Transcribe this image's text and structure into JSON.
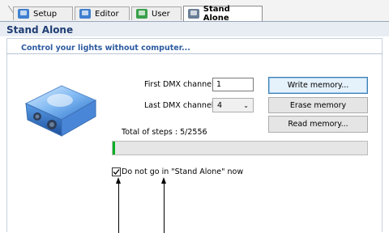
{
  "tabs": [
    {
      "label": "Setup",
      "icon": "setup-icon"
    },
    {
      "label": "Editor",
      "icon": "editor-icon"
    },
    {
      "label": "User",
      "icon": "user-icon"
    },
    {
      "label": "Stand Alone",
      "icon": "stand-alone-icon",
      "active": true
    }
  ],
  "page": {
    "title": "Stand Alone",
    "subtitle": "Control your lights without computer..."
  },
  "form": {
    "first_dmx_label": "First DMX channel",
    "first_dmx_value": "1",
    "last_dmx_label": "Last DMX channel",
    "last_dmx_value": "4",
    "total_steps": "Total of steps : 5/2556"
  },
  "buttons": {
    "write": "Write memory...",
    "erase": "Erase memory",
    "read": "Read memory..."
  },
  "progress": {
    "fraction": 0.002
  },
  "option": {
    "do_not_go_label": "Do not go in \"Stand Alone\" now",
    "checked": true
  },
  "colors": {
    "title": "#1f3d73",
    "subtitle": "#2c5aa0",
    "progress_fill": "#06b025",
    "default_button_border": "#3c7fb1"
  }
}
